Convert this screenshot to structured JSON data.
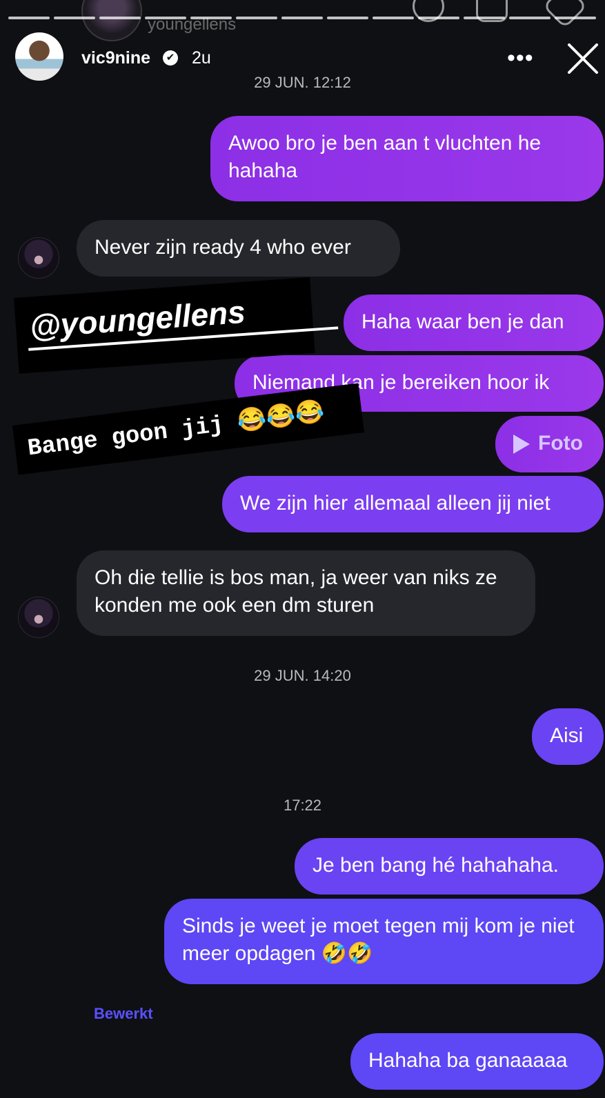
{
  "header": {
    "ghost_username": "youngellens",
    "username": "vic9nine",
    "verified_icon": "✔",
    "time_ago": "2u",
    "more_icon": "•••",
    "close_icon": "close-icon"
  },
  "timestamps": [
    "29 JUN. 12:12",
    "29 JUN. 14:20",
    "17:22"
  ],
  "messages": [
    {
      "from": "me",
      "text": "Awoo bro je ben aan t vluchten he hahaha"
    },
    {
      "from": "them",
      "text": "Never zijn ready 4 who ever"
    },
    {
      "from": "me",
      "text": "Haha waar ben je dan"
    },
    {
      "from": "me",
      "text": "Niemand kan je bereiken hoor ik"
    },
    {
      "from": "me",
      "text": "Foto"
    },
    {
      "from": "me",
      "text": "We zijn hier allemaal alleen jij niet"
    },
    {
      "from": "them",
      "text": "Oh die tellie is bos man, ja weer van niks ze konden me ook een dm sturen"
    },
    {
      "from": "me",
      "text": "Aisi"
    },
    {
      "from": "me",
      "text": "Je ben bang hé hahahaha."
    },
    {
      "from": "me",
      "text": "Sinds je weet je moet tegen mij kom je niet meer opdagen 🤣🤣"
    },
    {
      "from": "me",
      "text": "Hahaha ba ganaaaaa"
    }
  ],
  "stickers": {
    "mention": "@youngellens",
    "caption": "Bange goon jij 😂😂😂"
  },
  "edited_label": "Bewerkt",
  "colors": {
    "background": "#0f1014",
    "incoming_bubble": "#26272c",
    "outgoing_purple": "#8c2fe6",
    "outgoing_blue": "#5e47f4",
    "edited_label": "#5b50ff"
  }
}
